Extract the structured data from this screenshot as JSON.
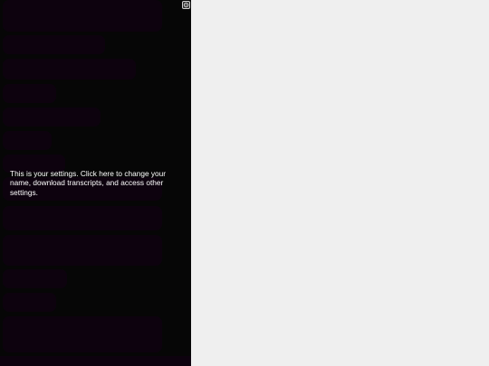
{
  "settings": {
    "tooltip": "This is your settings. Click here to change your name, download transcripts, and access other settings.",
    "button_icon": "gear-icon"
  },
  "colors": {
    "panel_bg": "#1c1c1c",
    "bubble_bg": "#3b0b43",
    "meta_text": "#0fa3b0",
    "overlay": "rgba(0,0,0,0.78)",
    "page_bg": "#efefef"
  },
  "messages": [
    {
      "meta": "",
      "text": ""
    },
    {
      "meta": "",
      "text": ""
    },
    {
      "meta": "",
      "text": ""
    },
    {
      "meta": "",
      "text": ""
    },
    {
      "meta": "",
      "text": ""
    },
    {
      "meta": "",
      "text": ""
    },
    {
      "meta": "",
      "text": ""
    },
    {
      "meta": "",
      "text": ""
    },
    {
      "meta": "",
      "text": ""
    },
    {
      "meta": "",
      "text": ""
    },
    {
      "meta": "",
      "text": ""
    },
    {
      "meta": "",
      "text": ""
    },
    {
      "meta": "",
      "text": ""
    }
  ]
}
